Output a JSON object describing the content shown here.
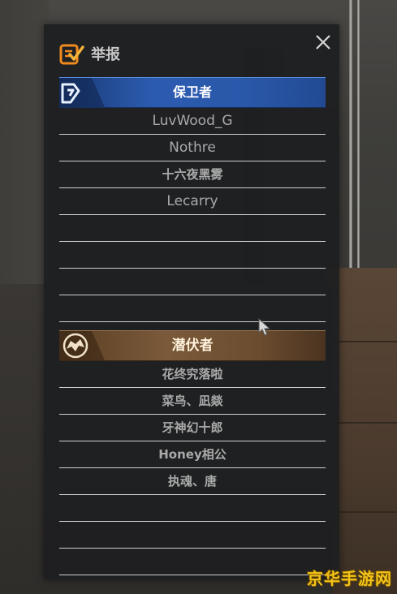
{
  "dialog": {
    "title": "举报",
    "icon": "report-icon",
    "close_icon": "close-icon"
  },
  "teams": [
    {
      "name": "保卫者",
      "icon": "defender-emblem-icon",
      "color": "#2b5bb0",
      "players": [
        "LuvWood_G",
        "Nothre",
        "十六夜黑雾",
        "Lecarry",
        "",
        "",
        "",
        "",
        ""
      ]
    },
    {
      "name": "潜伏者",
      "icon": "lurker-emblem-icon",
      "color": "#7a5a3a",
      "players": [
        "花终究落啦",
        "菜鸟、凪燚",
        "牙神幻十郎",
        "Honey相公",
        "执魂、唐",
        "",
        "",
        ""
      ]
    }
  ],
  "watermark": "京华手游网"
}
